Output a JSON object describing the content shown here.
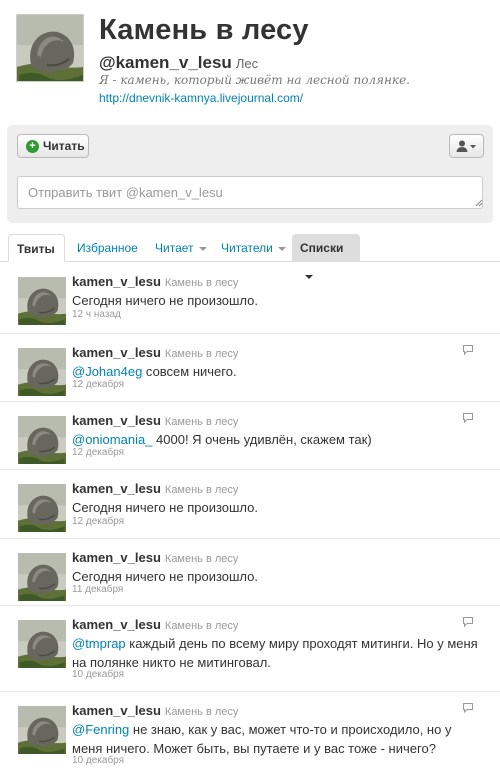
{
  "profile": {
    "name": "Камень в лесу",
    "handle": "@kamen_v_lesu",
    "location": "Лес",
    "bio": "Я - камень, который живёт на лесной полянке.",
    "url": "http://dnevnik-kamnya.livejournal.com/"
  },
  "actions": {
    "follow_label": "Читать",
    "tweet_placeholder": "Отправить твит @kamen_v_lesu"
  },
  "tabs": [
    {
      "label": "Твиты"
    },
    {
      "label": "Избранное"
    },
    {
      "label": "Читает"
    },
    {
      "label": "Читатели"
    },
    {
      "label": "Списки"
    }
  ],
  "tweets": [
    {
      "screen_name": "kamen_v_lesu",
      "full_name": "Камень в лесу",
      "mention": "",
      "text": "Сегодня ничего не произошло.",
      "time": "12 ч назад"
    },
    {
      "screen_name": "kamen_v_lesu",
      "full_name": "Камень в лесу",
      "mention": "@Johan4eg",
      "text": " совсем ничего.",
      "time": "12 декабря"
    },
    {
      "screen_name": "kamen_v_lesu",
      "full_name": "Камень в лесу",
      "mention": "@oniomania_",
      "text": " 4000! Я очень удивлён, скажем так)",
      "time": "12 декабря"
    },
    {
      "screen_name": "kamen_v_lesu",
      "full_name": "Камень в лесу",
      "mention": "",
      "text": "Сегодня ничего не произошло.",
      "time": "12 декабря"
    },
    {
      "screen_name": "kamen_v_lesu",
      "full_name": "Камень в лесу",
      "mention": "",
      "text": "Сегодня ничего не произошло.",
      "time": "11 декабря"
    },
    {
      "screen_name": "kamen_v_lesu",
      "full_name": "Камень в лесу",
      "mention": "@tmprap",
      "text": " каждый день по всему миру проходят митинги. Но у меня на полянке никто не митинговал.",
      "time": "10 декабря"
    },
    {
      "screen_name": "kamen_v_lesu",
      "full_name": "Камень в лесу",
      "mention": "@Fenring",
      "text": " не знаю, как у вас, может что-то и происходило, но у меня ничего. Может быть, вы путаете и у вас тоже - ничего?",
      "time": "10 декабря"
    }
  ]
}
